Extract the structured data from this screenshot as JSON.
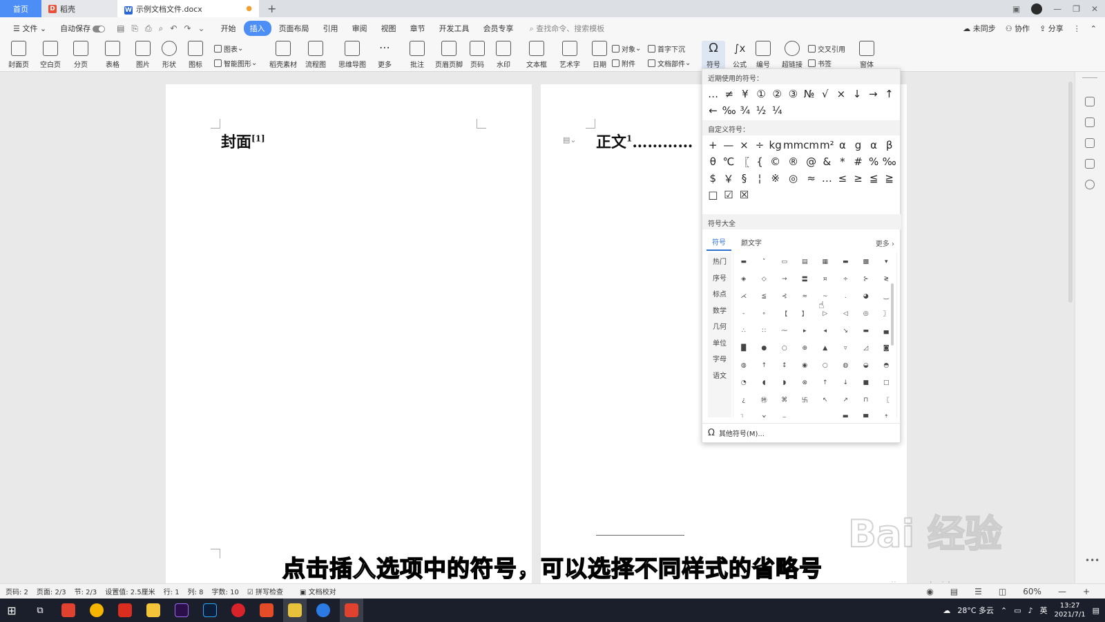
{
  "tabs": {
    "home": "首页",
    "daoke": "稻壳",
    "doc": "示例文档文件.docx"
  },
  "menu": {
    "file": "文件",
    "autosave": "自动保存",
    "items": [
      "开始",
      "插入",
      "页面布局",
      "引用",
      "审阅",
      "视图",
      "章节",
      "开发工具",
      "会员专享"
    ],
    "search": "查找命令、搜索模板",
    "sync": "未同步",
    "collab": "协作",
    "share": "分享"
  },
  "ribbon": {
    "cover": "封面页",
    "blank": "空白页",
    "pagebreak": "分页",
    "table": "表格",
    "picture": "图片",
    "shape": "形状",
    "icon": "图标",
    "chart": "图表",
    "smart": "智能图形",
    "daoke_mat": "稻壳素材",
    "flow": "流程图",
    "mind": "思维导图",
    "more": "更多",
    "comment": "批注",
    "header": "页眉页脚",
    "pagenum": "页码",
    "watermark": "水印",
    "textbox": "文本框",
    "wordart": "艺术字",
    "date": "日期",
    "object": "对象",
    "attach": "附件",
    "dropcap": "首字下沉",
    "docpart": "文档部件",
    "symbol": "符号",
    "formula": "公式",
    "number": "编号",
    "hyperlink": "超链接",
    "crossref": "交叉引用",
    "bookmark": "书签",
    "window": "窗体"
  },
  "doc": {
    "page1_heading": "封面",
    "page1_sup": "[1]",
    "page2_heading": "正文",
    "page2_sup": "1",
    "page2_dots": "…………"
  },
  "panel": {
    "recent_title": "近期使用的符号：",
    "recent": [
      "…",
      "≠",
      "¥",
      "①",
      "②",
      "③",
      "№",
      "√",
      "×",
      "↓",
      "→",
      "↑",
      "←",
      "‰",
      "¾",
      "½",
      "¼"
    ],
    "custom_title": "自定义符号：",
    "custom": [
      "+",
      "—",
      "×",
      "÷",
      "kg",
      "mm",
      "cm",
      "m²",
      "α",
      "g",
      "α",
      "β",
      "θ",
      "℃",
      "〖",
      "{",
      "©",
      "®",
      "@",
      "&",
      "*",
      "#",
      "%",
      "‰",
      "$",
      "￥",
      "§",
      "¦",
      "※",
      "◎",
      "≈",
      "…",
      "≤",
      "≥",
      "≦",
      "≧",
      "□",
      "☑",
      "☒"
    ],
    "all_title": "符号大全",
    "tab_symbol": "符号",
    "tab_kaomoji": "颜文字",
    "more": "更多",
    "categories": [
      "热门",
      "序号",
      "标点",
      "数学",
      "几何",
      "单位",
      "字母",
      "语文"
    ],
    "grid": [
      "▬",
      "˅",
      "▭",
      "▤",
      "▦",
      "▬",
      "▩",
      "▾",
      "◈",
      "◇",
      "→",
      "〓",
      "¤",
      "÷",
      "⊱",
      "≷",
      "⋌",
      "≦",
      "⊰",
      "≈",
      "~",
      ".",
      "◕",
      "‿",
      "-",
      "∘",
      "【",
      "】",
      "▷",
      "◁",
      "◎",
      "〗",
      "∴",
      "∷",
      "⁓",
      "▸",
      "◂",
      "↘",
      "▬",
      "▄",
      "█",
      "●",
      "○",
      "⊕",
      "▲",
      "▿",
      "◿",
      "◙",
      "◍",
      "↑",
      "↕",
      "◉",
      "○",
      "◍",
      "◒",
      "◓",
      "◔",
      "◖",
      "◗",
      "⊗",
      "↑",
      "↓",
      "■",
      "□",
      "¿",
      "㊕",
      "⌘",
      "卐",
      "↖",
      "↗",
      "⊓",
      "〖",
      "〗",
      "×",
      "⌣",
      "▁",
      "▂",
      "▆",
      "▇",
      "⇡"
    ],
    "other": "其他符号(M)..."
  },
  "subtitle": "点击插入选项中的符号，可以选择不同样式的省略号",
  "watermark": "Bai 经验",
  "watermark_url": "jingyan.baidu.com",
  "status": {
    "pagecount": "页码: 2",
    "page": "页面: 2/3",
    "section": "节: 2/3",
    "setting": "设置值: 2.5厘米",
    "row": "行: 1",
    "col": "列: 8",
    "words": "字数: 10",
    "spell": "拼写检查",
    "check": "文档校对",
    "zoom": "60%"
  },
  "taskbar": {
    "weather": "28°C 多云",
    "lang": "英",
    "time": "13:27",
    "date": "2021/7/1"
  }
}
